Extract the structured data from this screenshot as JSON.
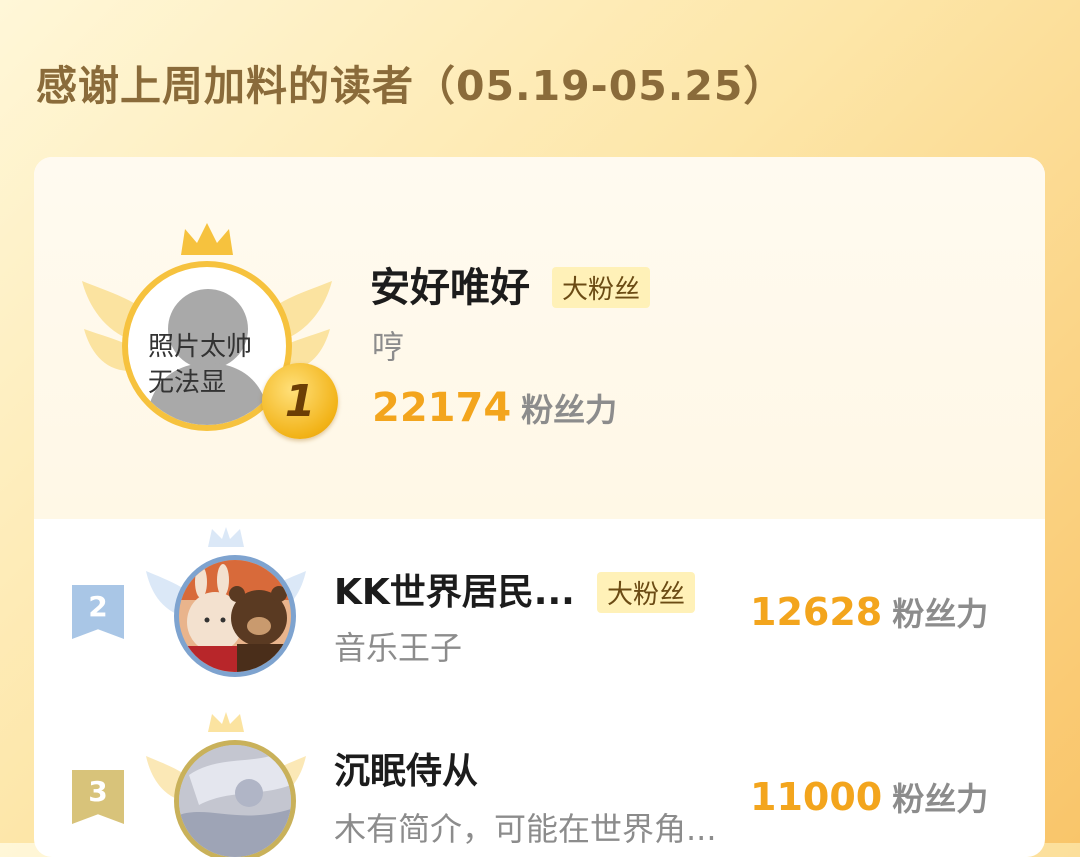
{
  "header": {
    "title": "感谢上周加料的读者（05.19-05.25）"
  },
  "top_reader": {
    "rank": "1",
    "name": "安好唯好",
    "badge": "大粉丝",
    "bio": "哼",
    "score": "22174",
    "score_unit": "粉丝力",
    "avatar_placeholder_line1": "照片太帅",
    "avatar_placeholder_line2": "无法显"
  },
  "readers": [
    {
      "rank": "2",
      "name": "KK世界居民...",
      "badge": "大粉丝",
      "bio": "音乐王子",
      "score": "12628",
      "score_unit": "粉丝力"
    },
    {
      "rank": "3",
      "name": "沉眠侍从",
      "badge": "",
      "bio": "木有简介，可能在世界角...",
      "score": "11000",
      "score_unit": "粉丝力"
    }
  ],
  "colors": {
    "accent_orange": "#f3a51d",
    "title_brown": "#8a6b3a",
    "rank2_blue": "#a9c6e6",
    "rank3_gold": "#d8c37a"
  }
}
